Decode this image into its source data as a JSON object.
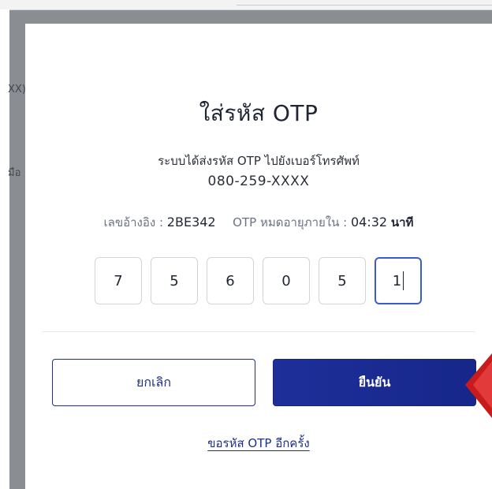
{
  "background": {
    "fragment_1": "XX)",
    "fragment_2": "มือ"
  },
  "modal": {
    "title": "ใส่รหัส OTP",
    "description_line1": "ระบบได้ส่งรหัส OTP ไปยังเบอร์โทรศัพท์",
    "phone_number": "080-259-XXXX",
    "ref_label": "เลขอ้างอิง :",
    "ref_value": "2BE342",
    "expire_label": "OTP หมดอายุภายใน :",
    "expire_time": "04:32",
    "expire_unit": "นาที",
    "otp_digits": [
      "7",
      "5",
      "6",
      "0",
      "5",
      "1"
    ],
    "cancel_label": "ยกเลิก",
    "confirm_label": "ยืนยัน",
    "resend_label": "ขอรหัส OTP อีกครั้ง"
  },
  "colors": {
    "primary": "#1f2e8a",
    "pointer_arrow": "#d11f1f",
    "active_box_border": "#3b5bd1"
  }
}
